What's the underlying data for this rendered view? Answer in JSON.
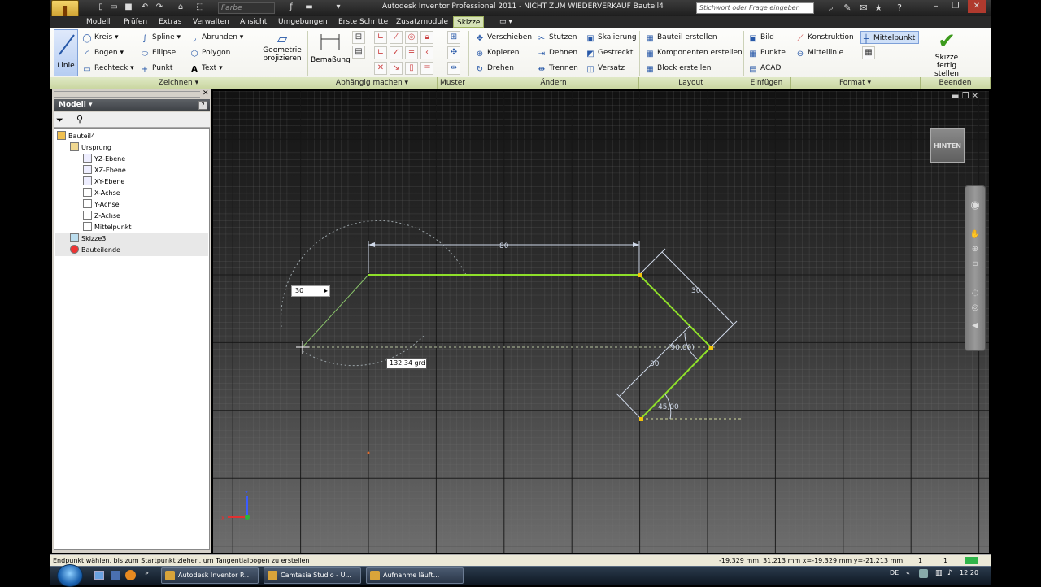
{
  "title_bar": {
    "title": "Autodesk Inventor Professional 2011 - NICHT ZUM WIEDERVERKAUF   Bauteil4",
    "color_field": "Farbe",
    "help_search_placeholder": "Stichwort oder Frage eingeben"
  },
  "menu_tabs": [
    "Modell",
    "Prüfen",
    "Extras",
    "Verwalten",
    "Ansicht",
    "Umgebungen",
    "Erste Schritte",
    "Zusatzmodule",
    "Skizze"
  ],
  "active_tab": "Skizze",
  "ribbon": {
    "zeichnen": {
      "label": "Zeichnen",
      "big_button": "Linie",
      "items": [
        "Kreis",
        "Bogen",
        "Rechteck",
        "Spline",
        "Ellipse",
        "Punkt",
        "Abrunden",
        "Polygon",
        "Text"
      ],
      "geometry_project_line1": "Geometrie",
      "geometry_project_line2": "projizieren"
    },
    "abhaengig": {
      "label": "Abhängig machen",
      "big_button": "Bemaßung"
    },
    "muster": {
      "label": "Muster"
    },
    "aendern": {
      "label": "Ändern",
      "items": [
        "Verschieben",
        "Kopieren",
        "Drehen",
        "Stutzen",
        "Dehnen",
        "Trennen",
        "Skalierung",
        "Gestreckt",
        "Versatz"
      ]
    },
    "layout": {
      "label": "Layout",
      "items": [
        "Bauteil erstellen",
        "Komponenten erstellen",
        "Block erstellen"
      ]
    },
    "einfuegen": {
      "label": "Einfügen",
      "items": [
        "Bild",
        "Punkte",
        "ACAD"
      ]
    },
    "format": {
      "label": "Format",
      "items": [
        "Konstruktion",
        "Mittellinie",
        "Mittelpunkt"
      ]
    },
    "beenden": {
      "label": "Beenden",
      "finish_line1": "Skizze",
      "finish_line2": "fertig stellen"
    }
  },
  "browser": {
    "header": "Modell",
    "tree": [
      {
        "label": "Bauteil4",
        "level": 0
      },
      {
        "label": "Ursprung",
        "level": 1
      },
      {
        "label": "YZ-Ebene",
        "level": 2
      },
      {
        "label": "XZ-Ebene",
        "level": 2
      },
      {
        "label": "XY-Ebene",
        "level": 2
      },
      {
        "label": "X-Achse",
        "level": 2
      },
      {
        "label": "Y-Achse",
        "level": 2
      },
      {
        "label": "Z-Achse",
        "level": 2
      },
      {
        "label": "Mittelpunkt",
        "level": 2
      },
      {
        "label": "Skizze3",
        "level": 1
      },
      {
        "label": "Bauteilende",
        "level": 1
      }
    ]
  },
  "viewport": {
    "view_cube": "HINTEN",
    "dim_80": "80",
    "dim_30_top": "30",
    "dim_30_mid": "30",
    "angle_90": "(90,00)",
    "angle_45": "45,00",
    "input_value": "30",
    "angle_tooltip": "132,34 grd"
  },
  "status_bar": {
    "prompt": "Endpunkt wählen, bis zum Startpunkt ziehen, um Tangentialbogen zu erstellen",
    "coords": "-19,329 mm, 31,213 mm  x=-19,329 mm   y=-21,213 mm",
    "count1": "1",
    "count2": "1"
  },
  "taskbar": {
    "tasks": [
      "Autodesk Inventor P...",
      "Camtasia Studio - U...",
      "Aufnahme läuft..."
    ],
    "lang": "DE",
    "time": "12:20"
  }
}
